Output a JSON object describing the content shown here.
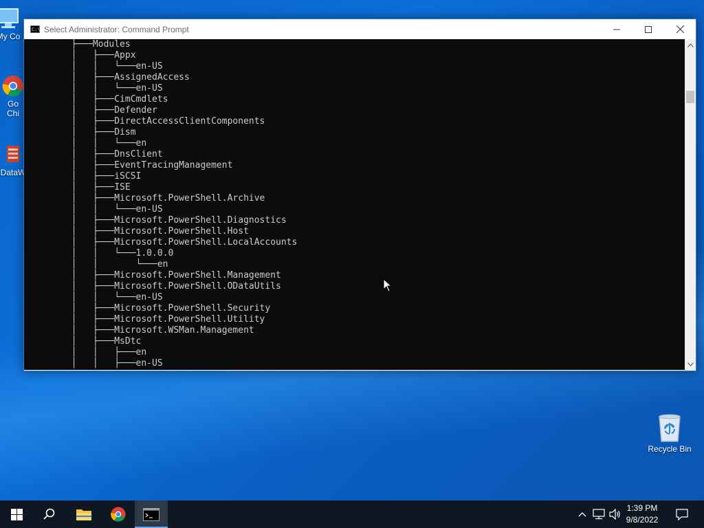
{
  "desktop": {
    "icons": [
      {
        "label": "My Co"
      },
      {
        "label": "Go\nChi"
      },
      {
        "label": "DataW"
      }
    ],
    "recycle_bin": {
      "label": "Recycle Bin"
    }
  },
  "window": {
    "title": "Select Administrator: Command Prompt",
    "icon_text": "C:\\_",
    "console_lines": [
      "        ├───Modules",
      "        │   ├───Appx",
      "        │   │   └───en-US",
      "        │   ├───AssignedAccess",
      "        │   │   └───en-US",
      "        │   ├───CimCmdlets",
      "        │   ├───Defender",
      "        │   ├───DirectAccessClientComponents",
      "        │   ├───Dism",
      "        │   │   └───en",
      "        │   ├───DnsClient",
      "        │   ├───EventTracingManagement",
      "        │   ├───iSCSI",
      "        │   ├───ISE",
      "        │   ├───Microsoft.PowerShell.Archive",
      "        │   │   └───en-US",
      "        │   ├───Microsoft.PowerShell.Diagnostics",
      "        │   ├───Microsoft.PowerShell.Host",
      "        │   ├───Microsoft.PowerShell.LocalAccounts",
      "        │   │   └───1.0.0.0",
      "        │   │       └───en",
      "        │   ├───Microsoft.PowerShell.Management",
      "        │   ├───Microsoft.PowerShell.ODataUtils",
      "        │   │   └───en-US",
      "        │   ├───Microsoft.PowerShell.Security",
      "        │   ├───Microsoft.PowerShell.Utility",
      "        │   ├───Microsoft.WSMan.Management",
      "        │   ├───MsDtc",
      "        │   │   ├───en",
      "        │   │   ├───en-US"
    ]
  },
  "taskbar": {
    "clock_time": "1:39 PM",
    "clock_date": "9/8/2022"
  },
  "colors": {
    "console_bg": "#0c0c0c",
    "console_fg": "#cccccc",
    "taskbar_bg": "#0e1722",
    "desktop_accent": "#0b6fd8"
  }
}
